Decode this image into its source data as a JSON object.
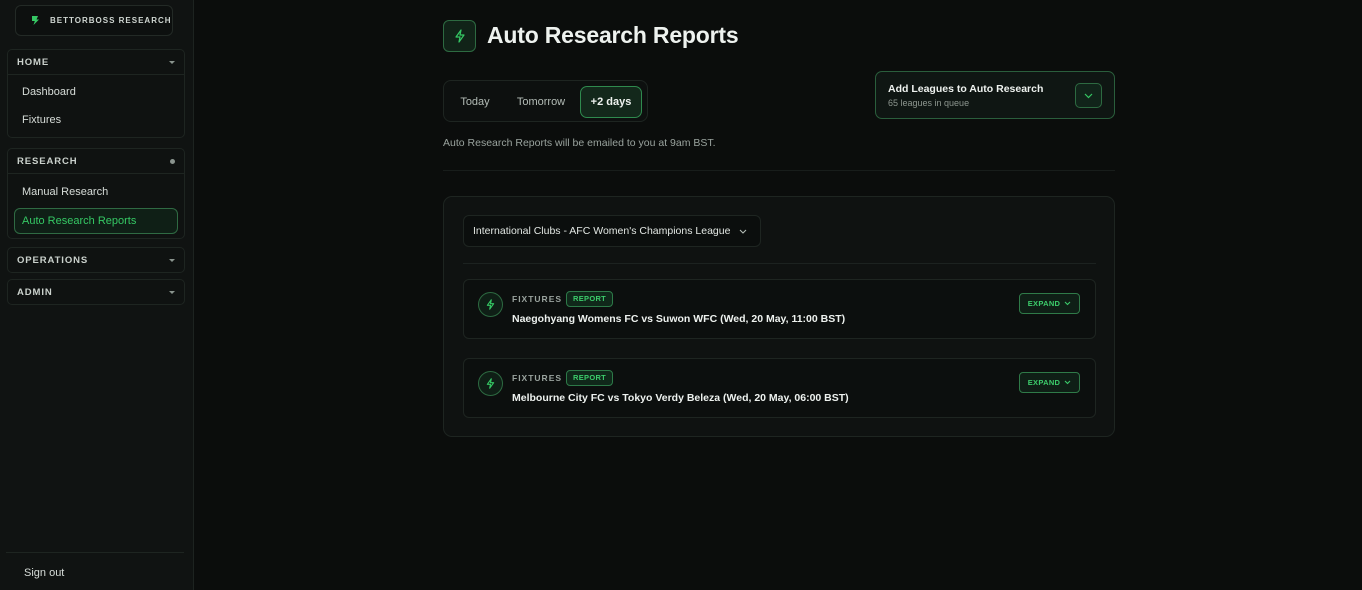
{
  "brand": {
    "name": "BETTORBOSS RESEARCH",
    "icon": "bettorboss-logo-icon"
  },
  "sidebar": {
    "groups": [
      {
        "label": "HOME",
        "items": [
          "Dashboard",
          "Fixtures"
        ]
      },
      {
        "label": "RESEARCH",
        "items": [
          "Manual Research",
          "Auto Research Reports"
        ],
        "active_item": "Auto Research Reports"
      },
      {
        "label": "OPERATIONS",
        "items": []
      },
      {
        "label": "ADMIN",
        "items": []
      }
    ],
    "sign_out": "Sign out"
  },
  "page": {
    "title": "Auto Research Reports",
    "title_icon": "lightning-icon"
  },
  "date_tabs": {
    "items": [
      "Today",
      "Tomorrow",
      "+2 days"
    ],
    "selected": "+2 days"
  },
  "notice": "Auto Research Reports will be emailed to you at 9am BST.",
  "add_leagues": {
    "title": "Add Leagues to Auto Research",
    "subtitle": "65 leagues in queue",
    "icon": "chevron-down-icon"
  },
  "league_selector": {
    "value": "International Clubs - AFC Women's Champions League"
  },
  "fixtures": [
    {
      "kicker": "FIXTURES",
      "badge": "REPORT",
      "title": "Naegohyang Womens FC vs Suwon WFC (Wed, 20 May, 11:00 BST)",
      "action": "EXPAND"
    },
    {
      "kicker": "FIXTURES",
      "badge": "REPORT",
      "title": "Melbourne City FC vs Tokyo Verdy Beleza (Wed, 20 May, 06:00 BST)",
      "action": "EXPAND"
    }
  ],
  "colors": {
    "accent": "#35c864",
    "background": "#0b0d0c",
    "sidebar": "#101312"
  }
}
